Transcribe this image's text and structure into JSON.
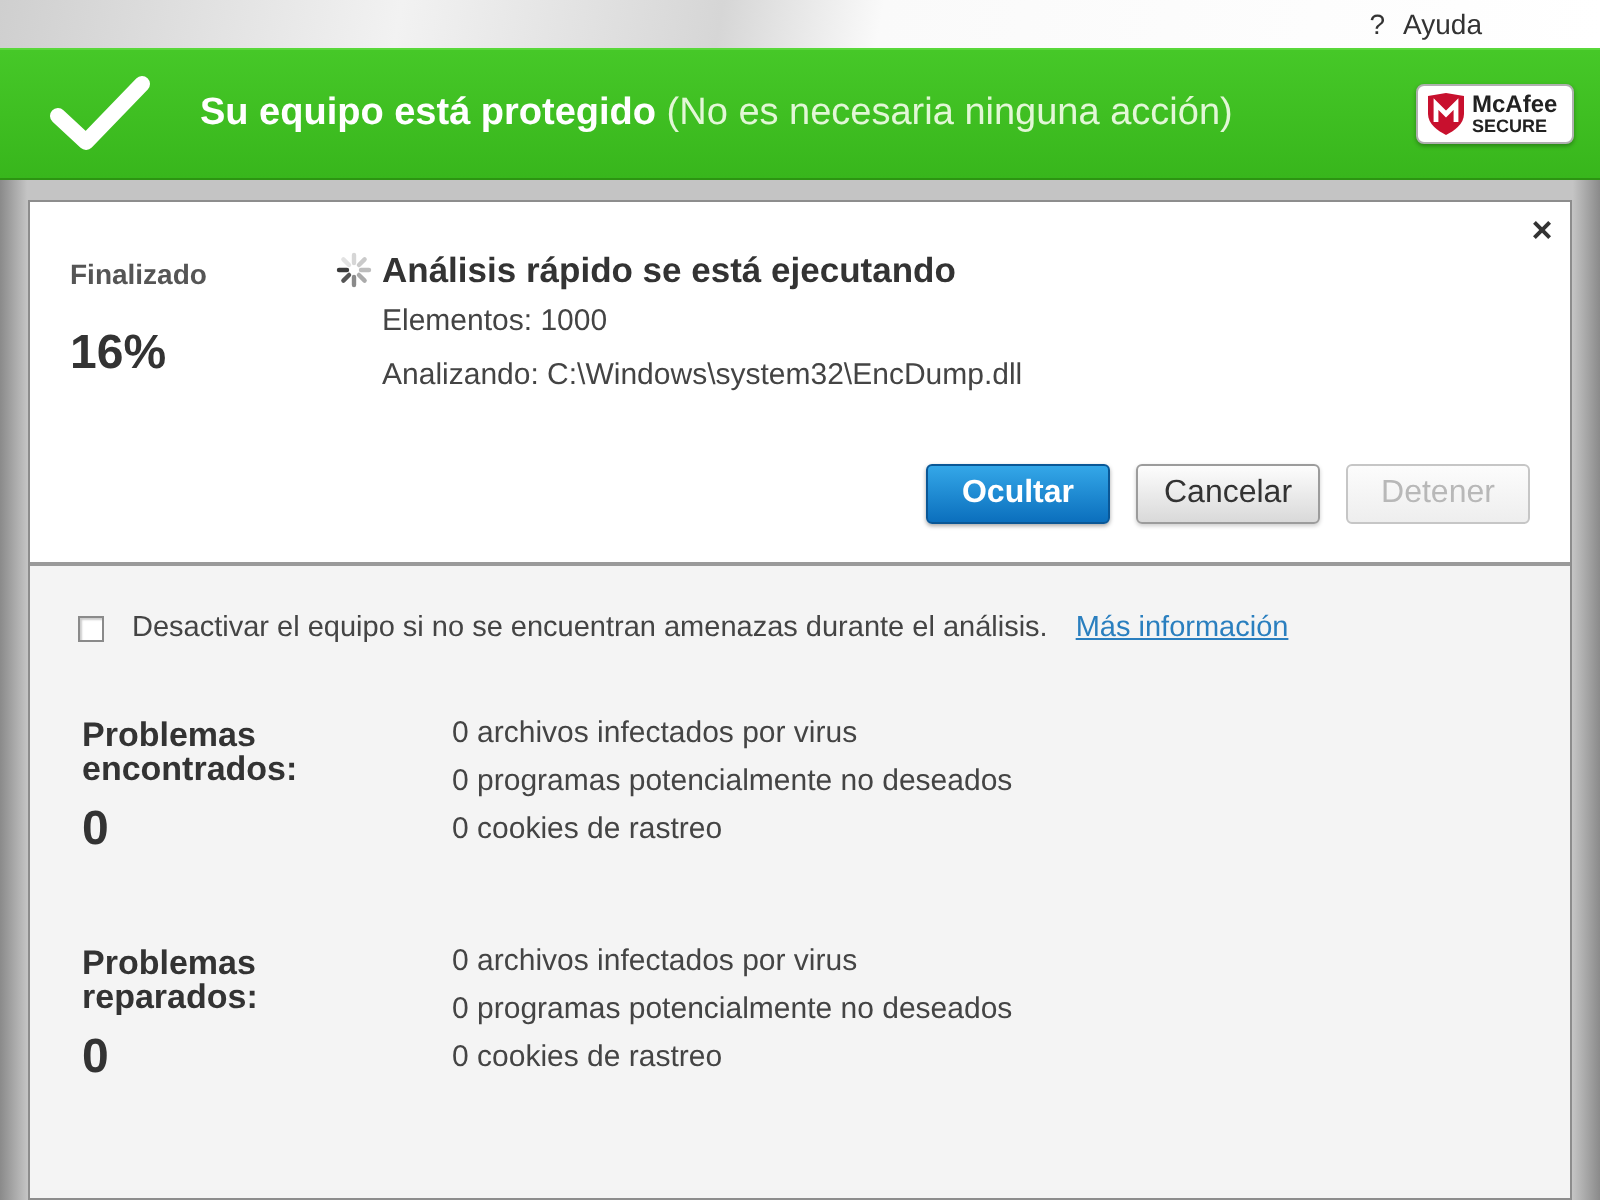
{
  "header": {
    "help_icon": "?",
    "help_label": "Ayuda"
  },
  "banner": {
    "message": "**Su equipo está protegido** (No es necesaria ninguna acción)",
    "badge": {
      "brand": "McAfee",
      "tagline": "SECURE"
    }
  },
  "scan": {
    "progress_label": "Finalizado",
    "percent": "16%",
    "title": "Análisis rápido se está ejecutando",
    "items": "Elementos: 1000",
    "current": "Analizando: C:\\Windows\\system32\\EncDump.dll",
    "close": "×"
  },
  "buttons": [
    {
      "label": "Ocultar",
      "kind": "primary",
      "disabled": false
    },
    {
      "label": "Cancelar",
      "kind": "secondary",
      "disabled": false
    },
    {
      "label": "Detener",
      "kind": "secondary",
      "disabled": true
    }
  ],
  "option": {
    "checked": false,
    "label": "Desactivar el equipo si no se encuentran amenazas durante el análisis.",
    "link": "Más información"
  },
  "groups": [
    {
      "title": "Problemas encontrados:",
      "count": "0",
      "lines": [
        "0 archivos infectados por virus",
        "0 programas potencialmente no deseados",
        "0 cookies de rastreo"
      ]
    },
    {
      "title": "Problemas reparados:",
      "count": "0",
      "lines": [
        "0 archivos infectados por virus",
        "0 programas potencialmente no deseados",
        "0 cookies de rastreo"
      ]
    }
  ]
}
